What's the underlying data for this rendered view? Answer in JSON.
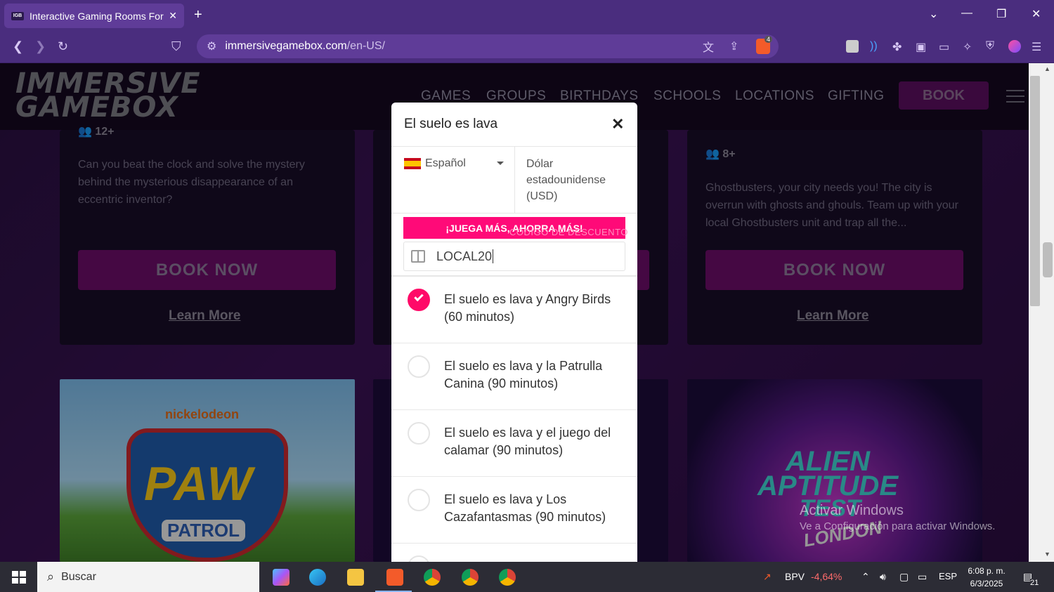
{
  "browser": {
    "tab_title": "Interactive Gaming Rooms For /",
    "favicon_text": "IGB",
    "url_host": "immersivegamebox.com",
    "url_path": "/en-US/",
    "brave_badge": "4"
  },
  "site": {
    "logo_line1": "IMMERSIVE",
    "logo_line2": "GAMEBOX",
    "nav": [
      "GAMES",
      "GROUPS",
      "BIRTHDAYS",
      "SCHOOLS",
      "LOCATIONS",
      "GIFTING"
    ],
    "book_label": "BOOK",
    "cards": [
      {
        "age": "12+",
        "description": "Can you beat the clock and solve the mystery behind the mysterious disappearance of an eccentric inventor?",
        "book_label": "BOOK NOW",
        "learn_label": "Learn More"
      },
      {
        "age": "8+",
        "description": "Ghostbusters, your city needs you! The city is overrun with ghosts and ghouls. Team up with your local Ghostbusters unit and trap all the...",
        "book_label": "BOOK NOW",
        "learn_label": "Learn More"
      }
    ],
    "paw_brand": "nickelodeon",
    "paw_title": "PAW",
    "paw_sub": "PATROL",
    "alien_line1": "ALIEN",
    "alien_line2": "APTITUDE",
    "alien_line3": "TEST",
    "alien_city": "LONDON"
  },
  "modal": {
    "title": "El suelo es lava",
    "language": "Español",
    "currency": "Dólar estadounidense (USD)",
    "promo_banner": "¡JUEGA MÁS, AHORRA MÁS!",
    "promo_ghost": "CÓDIGO DE DESCUENTO",
    "discount_code": "LOCAL20",
    "options": [
      {
        "label": "El suelo es lava y Angry Birds (60 minutos)",
        "selected": true
      },
      {
        "label": "El suelo es lava y la Patrulla Canina (90 minutos)",
        "selected": false
      },
      {
        "label": "El suelo es lava y el juego del calamar (90 minutos)",
        "selected": false
      },
      {
        "label": "El suelo es lava y Los Cazafantasmas (90 minutos)",
        "selected": false
      }
    ]
  },
  "windows": {
    "watermark_title": "Activar Windows",
    "watermark_sub": "Ve a Configuración para activar Windows.",
    "search_placeholder": "Buscar",
    "stock_name": "BPV",
    "stock_change": "-4,64%",
    "lang": "ESP",
    "time": "6:08 p. m.",
    "date": "6/3/2025",
    "notif_count": "21"
  },
  "colors": {
    "accent": "#ff0a68",
    "browser_chrome": "#4a2d7e",
    "book_button": "#6a0d67"
  }
}
